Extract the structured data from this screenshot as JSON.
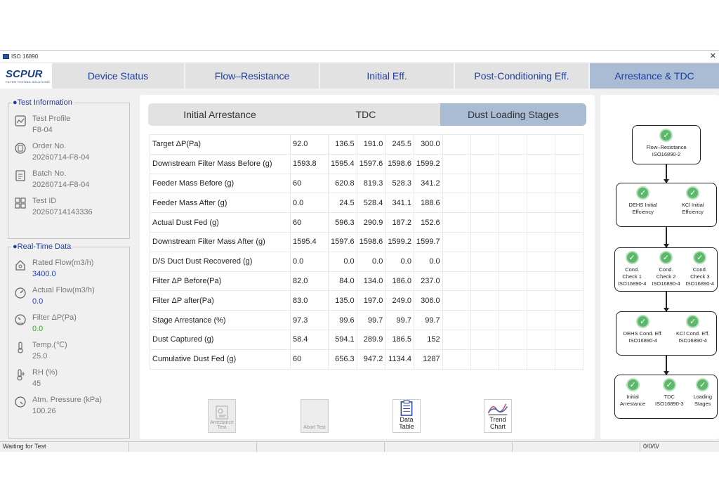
{
  "window": {
    "title": "ISO 16890"
  },
  "logo": {
    "name": "SCPUR",
    "tagline": "FILTER TESTING SOLUTIONS"
  },
  "tabs": [
    {
      "label": "Device Status"
    },
    {
      "label": "Flow–Resistance"
    },
    {
      "label": "Initial Eff."
    },
    {
      "label": "Post-Conditioning Eff."
    },
    {
      "label": "Arrestance & TDC"
    }
  ],
  "test_info": {
    "legend": "●Test Information",
    "items": [
      {
        "label": "Test Profile",
        "value": "F8-04",
        "icon": "profile-icon"
      },
      {
        "label": "Order No.",
        "value": "20260714-F8-04",
        "icon": "order-icon"
      },
      {
        "label": "Batch No.",
        "value": "20260714-F8-04",
        "icon": "batch-icon"
      },
      {
        "label": "Test ID",
        "value": "20260714143336",
        "icon": "id-icon"
      }
    ]
  },
  "realtime": {
    "legend": "●Real-Time Data",
    "items": [
      {
        "label": "Rated Flow(m3/h)",
        "value": "3400.0",
        "icon": "flow-icon"
      },
      {
        "label": "Actual Flow(m3/h)",
        "value": "0.0",
        "icon": "gauge-icon"
      },
      {
        "label": "Filter ΔP(Pa)",
        "value": "0.0",
        "icon": "pressure-gauge-icon"
      },
      {
        "label": "Temp.(℃)",
        "value": "25.0",
        "icon": "thermometer-icon"
      },
      {
        "label": "RH (%)",
        "value": "45",
        "icon": "humidity-icon"
      },
      {
        "label": "Atm. Pressure (kPa)",
        "value": "100.26",
        "icon": "barometer-icon"
      }
    ]
  },
  "subtabs": [
    {
      "label": "Initial Arrestance"
    },
    {
      "label": "TDC"
    },
    {
      "label": "Dust Loading Stages"
    }
  ],
  "table": {
    "rows": [
      {
        "name": "Target ΔP(Pa)",
        "values": [
          "92.0",
          "136.5",
          "191.0",
          "245.5",
          "300.0"
        ]
      },
      {
        "name": "Downstream Filter Mass Before (g)",
        "values": [
          "1593.8",
          "1595.4",
          "1597.6",
          "1598.6",
          "1599.2"
        ]
      },
      {
        "name": "Feeder Mass Before (g)",
        "values": [
          "60",
          "620.8",
          "819.3",
          "528.3",
          "341.2"
        ]
      },
      {
        "name": "Feeder Mass After (g)",
        "values": [
          "0.0",
          "24.5",
          "528.4",
          "341.1",
          "188.6"
        ]
      },
      {
        "name": "Actual Dust Fed (g)",
        "values": [
          "60",
          "596.3",
          "290.9",
          "187.2",
          "152.6"
        ]
      },
      {
        "name": "Downstream Filter Mass After (g)",
        "values": [
          "1595.4",
          "1597.6",
          "1598.6",
          "1599.2",
          "1599.7"
        ]
      },
      {
        "name": "D/S Duct Dust Recovered  (g)",
        "values": [
          "0.0",
          "0.0",
          "0.0",
          "0.0",
          "0.0"
        ]
      },
      {
        "name": "Filter ΔP Before(Pa)",
        "values": [
          "82.0",
          "84.0",
          "134.0",
          "186.0",
          "237.0"
        ]
      },
      {
        "name": "Filter ΔP after(Pa)",
        "values": [
          "83.0",
          "135.0",
          "197.0",
          "249.0",
          "306.0"
        ]
      },
      {
        "name": "Stage Arrestance (%)",
        "values": [
          "97.3",
          "99.6",
          "99.7",
          "99.7",
          "99.7"
        ]
      },
      {
        "name": "Dust Captured (g)",
        "values": [
          "58.4",
          "594.1",
          "289.9",
          "186.5",
          "152"
        ]
      },
      {
        "name": "Cumulative Dust Fed  (g)",
        "values": [
          "60",
          "656.3",
          "947.2",
          "1134.4",
          "1287"
        ]
      }
    ]
  },
  "buttons": {
    "arrestance_test": "Arrestance Test",
    "abort_test": "Abort Test",
    "data_table": "Data Table",
    "trend_chart": "Trend Chart"
  },
  "flow": {
    "nodes": [
      [
        {
          "l1": "Flow–Resistance",
          "l2": "ISO16890-2"
        }
      ],
      [
        {
          "l1": "DEHS Initial",
          "l2": "Effciency"
        },
        {
          "l1": "KCl Initial",
          "l2": "Effciency"
        }
      ],
      [
        {
          "l1": "Cond.",
          "l2": "Check 1",
          "l3": "ISO16890-4"
        },
        {
          "l1": "Cond.",
          "l2": "Check 2",
          "l3": "ISO16890-4"
        },
        {
          "l1": "Cond.",
          "l2": "Check 3",
          "l3": "ISO16890-4"
        }
      ],
      [
        {
          "l1": "DEHS Cond. Eff.",
          "l2": "ISO16890-4"
        },
        {
          "l1": "KCl Cond. Eff.",
          "l2": "ISO16890-4"
        }
      ],
      [
        {
          "l1": "Initial",
          "l2": "Arrestance"
        },
        {
          "l1": "TDC",
          "l2": "ISO16890-3"
        },
        {
          "l1": "Loading",
          "l2": "Stages"
        }
      ]
    ]
  },
  "status": {
    "message": "Waiting for Test",
    "counter": "0/0/0/"
  },
  "colors": {
    "accent": "#1f3f9f",
    "active_tab": "#a9bcd4",
    "check": "#5cb86a"
  }
}
